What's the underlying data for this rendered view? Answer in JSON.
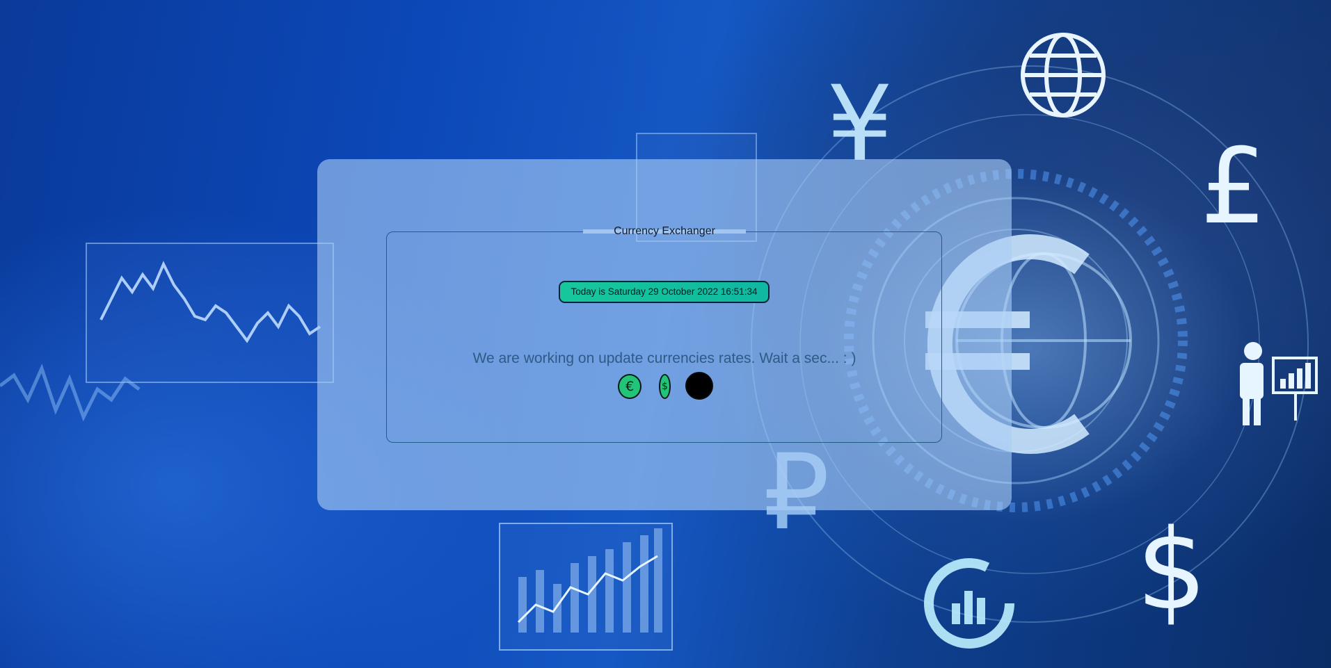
{
  "app": {
    "title": "Currency Exchanger",
    "date_text": "Today is Saturday 29 October 2022 16:51:34",
    "status_message": "We are working on update currencies rates. Wait a sec... : )"
  },
  "coins": {
    "euro_symbol": "€",
    "dollar_symbol": "$"
  },
  "background": {
    "currency_symbols": [
      "¥",
      "£",
      "$",
      "₽",
      "€"
    ]
  },
  "colors": {
    "accent": "#17c79c",
    "panel": "#aacdf5",
    "border": "#215e85",
    "message": "#2f5a86"
  }
}
